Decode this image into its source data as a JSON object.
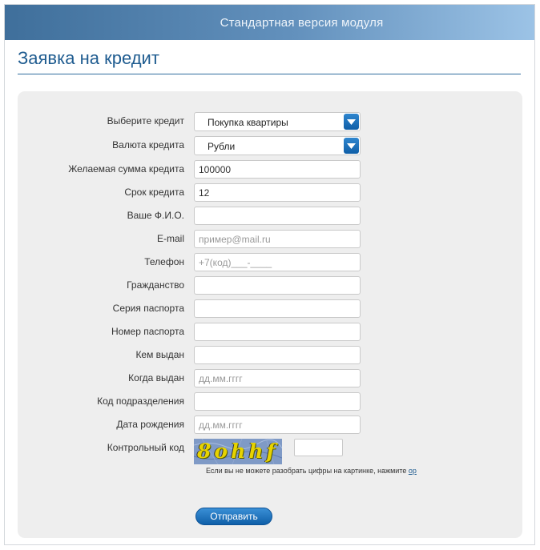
{
  "header": {
    "title": "Стандартная версия модуля"
  },
  "page": {
    "title": "Заявка на кредит"
  },
  "form": {
    "credit_type": {
      "label": "Выберите кредит",
      "value": "Покупка квартиры"
    },
    "currency": {
      "label": "Валюта кредита",
      "value": "Рубли"
    },
    "amount": {
      "label": "Желаемая сумма кредита",
      "value": "100000"
    },
    "term": {
      "label": "Срок кредита",
      "value": "12"
    },
    "full_name": {
      "label": "Ваше Ф.И.О.",
      "value": ""
    },
    "email": {
      "label": "E-mail",
      "placeholder": "пример@mail.ru"
    },
    "phone": {
      "label": "Телефон",
      "placeholder": "+7(код)___-____"
    },
    "citizenship": {
      "label": "Гражданство",
      "value": ""
    },
    "passport_series": {
      "label": "Серия паспорта",
      "value": ""
    },
    "passport_number": {
      "label": "Номер паспорта",
      "value": ""
    },
    "issued_by": {
      "label": "Кем выдан",
      "value": ""
    },
    "issue_date": {
      "label": "Когда выдан",
      "placeholder": "дд.мм.гггг"
    },
    "division_code": {
      "label": "Код подразделения",
      "value": ""
    },
    "birth_date": {
      "label": "Дата рождения",
      "placeholder": "дд.мм.гггг"
    },
    "captcha": {
      "label": "Контрольный код",
      "image_text": "8ohhf",
      "value": ""
    },
    "hint": {
      "text": "Если вы не можете разобрать цифры на картинке, нажмите ",
      "link": "ор"
    },
    "submit_label": "Отправить"
  },
  "colors": {
    "accent": "#1f5c90",
    "button": "#0f5fa8",
    "panel": "#eeeeee"
  },
  "icons": {
    "select_arrow": "chevron-down-icon"
  }
}
